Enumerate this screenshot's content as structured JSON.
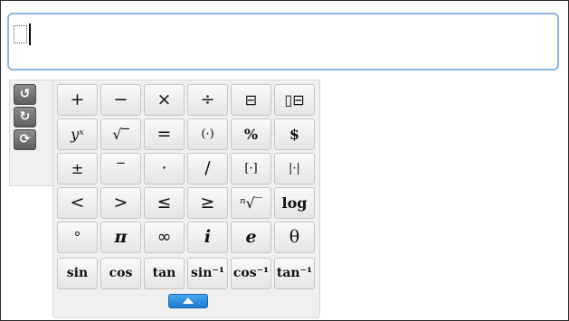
{
  "toolbar": {
    "undo_label": "↺",
    "redo_label": "↻",
    "refresh_label": "⟳"
  },
  "keypad": {
    "rows": [
      [
        "+",
        "−",
        "×",
        "÷",
        "⊟",
        "▯⊟"
      ],
      [
        "yˣ",
        "√‾",
        "=",
        "(·)",
        "%",
        "$"
      ],
      [
        "±",
        "‾",
        "·",
        "∕",
        "[·]",
        "|·|"
      ],
      [
        "<",
        ">",
        "≤",
        "≥",
        "ⁿ√‾",
        "log"
      ],
      [
        "°",
        "π",
        "∞",
        "i",
        "e",
        "θ"
      ],
      [
        "sin",
        "cos",
        "tan",
        "sin⁻¹",
        "cos⁻¹",
        "tan⁻¹"
      ]
    ]
  },
  "collapse": {
    "icon": "triangle-up-icon"
  },
  "colors": {
    "input_border": "#8fb3d9",
    "collapse_button": "#1f80d6"
  }
}
